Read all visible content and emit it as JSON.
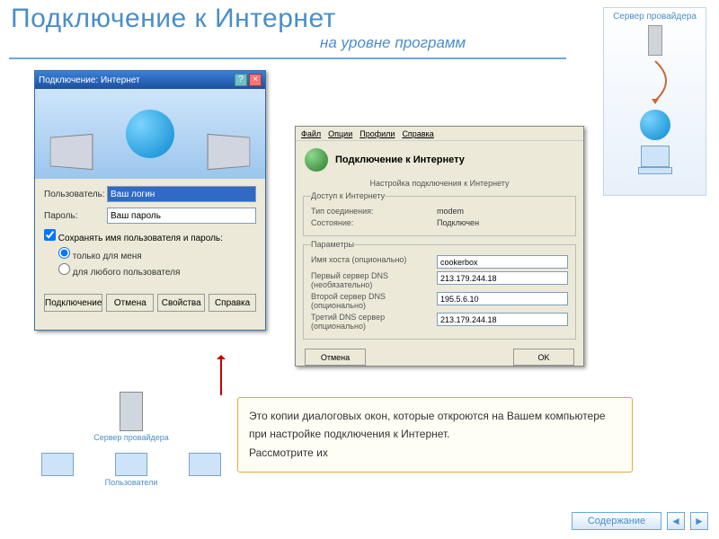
{
  "heading": "Подключение к Интернет",
  "subheading": "на уровне программ",
  "side": {
    "label_top": "Сервер провайдера"
  },
  "dlg1": {
    "title": "Подключение: Интернет",
    "user_label": "Пользователь:",
    "user_value": "Ваш логин",
    "pass_label": "Пароль:",
    "pass_value": "Ваш пароль",
    "save_chk": "Сохранять имя пользователя и пароль:",
    "radio_me": "только для меня",
    "radio_any": "для любого пользователя",
    "btn_connect": "Подключение",
    "btn_cancel": "Отмена",
    "btn_props": "Свойства",
    "btn_help": "Справка"
  },
  "dlg2": {
    "menu": {
      "file": "Файл",
      "options": "Опции",
      "profiles": "Профили",
      "help": "Справка"
    },
    "title": "Подключение к Интернету",
    "subtitle": "Настройка подключения к Интернету",
    "group1": {
      "legend": "Доступ к Интернету",
      "type_label": "Тип соединения:",
      "type_value": "modem",
      "state_label": "Состояние:",
      "state_value": "Подключен"
    },
    "group2": {
      "legend": "Параметры",
      "host_label": "Имя хоста (опционально)",
      "host_value": "cookerbox",
      "dns1_label": "Первый сервер DNS (необязательно)",
      "dns1_value": "213.179.244.18",
      "dns2_label": "Второй сервер DNS (опционально)",
      "dns2_value": "195.5.6.10",
      "dns3_label": "Третий DNS сервер (опционально)",
      "dns3_value": "213.179.244.18"
    },
    "btn_cancel": "Отмена",
    "btn_ok": "OK"
  },
  "net": {
    "server_label": "Сервер провайдера",
    "users_label": "Пользователи"
  },
  "info": {
    "line1": "Это копии диалоговых окон, которые откроются на Вашем компьютере",
    "line2": "при настройке подключения к Интернет.",
    "line3": "Рассмотрите их"
  },
  "nav": {
    "toc": "Содержание"
  }
}
